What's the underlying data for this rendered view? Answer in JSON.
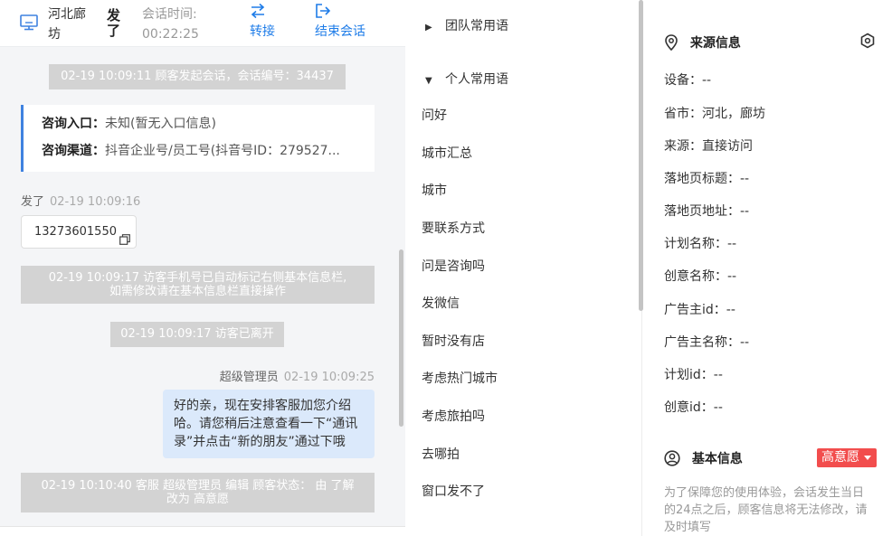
{
  "header": {
    "location": "河北廊坊",
    "visitor_name": "发了",
    "session_time_label": "会话时间:",
    "session_time_value": "00:22:25",
    "transfer_label": "转接",
    "end_label": "结束会话"
  },
  "chat": {
    "sys_start": "02-19 10:09:11 顾客发起会话，会话编号：34437",
    "consult_entry_key": "咨询入口：",
    "consult_entry_value": "未知(暂无入口信息)",
    "consult_channel_key": "咨询渠道：",
    "consult_channel_value": "抖音企业号/员工号(抖音号ID：279527...",
    "visitor_name": "发了",
    "visitor_time": "02-19 10:09:16",
    "phone": "13273601550",
    "sys_mark_line1": "02-19 10:09:17 访客手机号已自动标记右侧基本信息栏,",
    "sys_mark_line2": "如需修改请在基本信息栏直接操作",
    "sys_left": "02-19 10:09:17 访客已离开",
    "agent_name": "超级管理员",
    "agent_time": "02-19 10:09:25",
    "agent_message": "好的亲，现在安排客服加您介绍哈。请您稍后注意查看一下“通讯录”并点击“新的朋友”通过下哦",
    "sys_edit_line1": "02-19 10:10:40 客服 超级管理员 编辑 顾客状态： 由 了解",
    "sys_edit_line2": "改为 高意愿"
  },
  "phrases": {
    "team_group": "团队常用语",
    "personal_group": "个人常用语",
    "items": [
      "问好",
      "城市汇总",
      "城市",
      "要联系方式",
      "问是咨询吗",
      "发微信",
      "暂时没有店",
      "考虑热门城市",
      "考虑旅拍吗",
      "去哪拍",
      "窗口发不了"
    ]
  },
  "source_info": {
    "title": "来源信息",
    "rows": [
      "设备：--",
      "省市：河北，廊坊",
      "来源：直接访问",
      "落地页标题：--",
      "落地页地址：--",
      "计划名称：--",
      "创意名称：--",
      "广告主id：--",
      "广告主名称：--",
      "计划id：--",
      "创意id：--"
    ]
  },
  "basic_info": {
    "title": "基本信息",
    "intent": "高意愿",
    "notice": "为了保障您的使用体验，会话发生当日的24点之后，顾客信息将无法修改，请及时填写"
  },
  "colors": {
    "accent_blue": "#1e7ce8",
    "intent_red": "#f24d4d",
    "agent_bubble": "#dbe9fb",
    "system_gray": "#d3d3d3"
  }
}
